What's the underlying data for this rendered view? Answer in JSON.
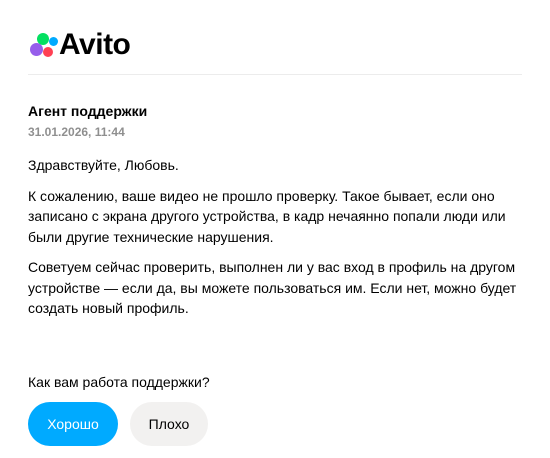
{
  "header": {
    "logo_text": "Avito",
    "logo_colors": {
      "green": "#04e061",
      "blue": "#00aaff",
      "purple": "#965eeb",
      "red": "#ff4053"
    }
  },
  "message": {
    "sender": "Агент поддержки",
    "timestamp": "31.01.2026, 11:44",
    "paragraphs": [
      "Здравствуйте, Любовь.",
      "К сожалению, ваше видео не прошло проверку. Такое бывает, если оно записано с экрана другого устройства, в кадр нечаянно попали люди или были другие технические нарушения.",
      "Советуем сейчас проверить, выполнен ли у вас вход в профиль на другом устройстве — если да, вы можете пользоваться им. Если нет, можно будет создать новый профиль."
    ]
  },
  "feedback": {
    "question": "Как вам работа поддержки?",
    "good_label": "Хорошо",
    "bad_label": "Плохо",
    "good_color": "#00aaff",
    "bad_color": "#f2f1f0"
  }
}
